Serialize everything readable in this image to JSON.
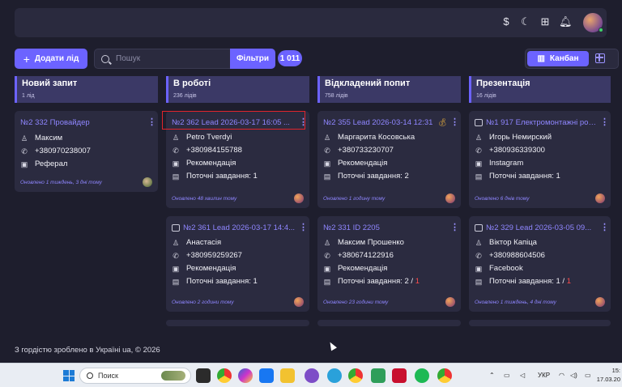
{
  "header": {
    "icons": [
      "dollar-icon",
      "moon-icon",
      "apps-icon",
      "bell-icon"
    ]
  },
  "toolbar": {
    "add_lead_label": "Додати лід",
    "search_placeholder": "Пошук",
    "filter_label": "Фільтри",
    "count_badge": "1 011",
    "kanban_label": "Канбан"
  },
  "columns": [
    {
      "title": "Новий запит",
      "count": "1 лід"
    },
    {
      "title": "В роботі",
      "count": "236 лідів"
    },
    {
      "title": "Відкладений попит",
      "count": "758 лідів"
    },
    {
      "title": "Презентація",
      "count": "16 лідів"
    }
  ],
  "cards": {
    "c0_0": {
      "title": "№2 332 Провайдер",
      "name": "Максим",
      "phone": "+380970238007",
      "source": "Реферал",
      "updated": "Оновлено 1 тиждень, 3 дні тому"
    },
    "c1_0": {
      "title": "№2 362 Lead 2026-03-17 16:05 ...",
      "name": "Petro Tverdyi",
      "phone": "+380984155788",
      "source": "Рекомендація",
      "task": "Поточні завдання: 1",
      "updated": "Оновлено 48 хвилин тому"
    },
    "c1_1": {
      "title": "№2 361 Lead 2026-03-17 14:4...",
      "name": "Анастасія",
      "phone": "+380959259267",
      "source": "Рекомендація",
      "task": "Поточні завдання: 1",
      "updated": "Оновлено 2 години тому"
    },
    "c2_0": {
      "title": "№2 355 Lead 2026-03-14 12:31",
      "name": "Маргарита Косовська",
      "phone": "+380733230707",
      "source": "Рекомендація",
      "task": "Поточні завдання: 2",
      "updated": "Оновлено 1 годину тому"
    },
    "c2_1": {
      "title": "№2 331 ID 2205",
      "name": "Максим Прошенко",
      "phone": "+380674122916",
      "source": "Рекомендація",
      "task": "Поточні завдання: 2 /",
      "task_overdue": "1",
      "updated": "Оновлено 23 години тому"
    },
    "c3_0": {
      "title": "№1 917 Електромонтажні роб...",
      "name": "Игорь Немирский",
      "phone": "+380936339300",
      "source": "Instagram",
      "task": "Поточні завдання: 1",
      "updated": "Оновлено 6 днів тому"
    },
    "c3_1": {
      "title": "№2 329 Lead 2026-03-05 09...",
      "name": "Віктор Капіца",
      "phone": "+380988604506",
      "source": "Facebook",
      "task": "Поточні завдання: 1 /",
      "task_overdue": "1",
      "updated": "Оновлено 1 тиждень, 4 дні тому"
    }
  },
  "footer": {
    "text": "З гордістю зроблено в Україні ua, © 2026"
  },
  "taskbar": {
    "search_label": "Поиск",
    "lang": "УКР",
    "time": "15:",
    "date": "17.03.20"
  }
}
